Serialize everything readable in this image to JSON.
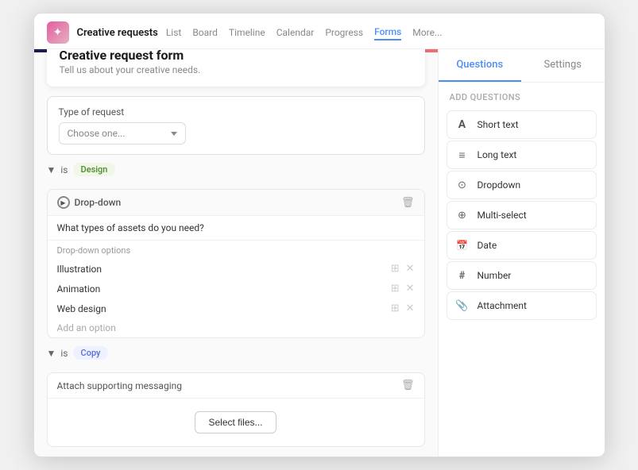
{
  "titleBar": {
    "appTitle": "Creative requests",
    "navItems": [
      "List",
      "Board",
      "Timeline",
      "Calendar",
      "Progress",
      "Forms",
      "More..."
    ],
    "activeNav": "Forms"
  },
  "form": {
    "title": "Creative request form",
    "subtitle": "Tell us about your creative needs.",
    "typeOfRequestLabel": "Type of request",
    "typeOfRequestPlaceholder": "Choose one...",
    "condition1": {
      "prefix": "is",
      "tag": "Design"
    },
    "dropdownSection": {
      "label": "Drop-down",
      "question": "What types of assets do you need?",
      "optionsLabel": "Drop-down options",
      "options": [
        "Illustration",
        "Animation",
        "Web design"
      ],
      "addOptionText": "Add an option"
    },
    "condition2": {
      "prefix": "is",
      "tag": "Copy"
    },
    "attachSection": {
      "label": "Attach supporting messaging",
      "selectFilesBtn": "Select files..."
    }
  },
  "rightPanel": {
    "tabs": [
      "Questions",
      "Settings"
    ],
    "activeTab": "Questions",
    "addQuestionsLabel": "Add questions",
    "questionTypes": [
      {
        "icon": "A",
        "label": "Short text"
      },
      {
        "icon": "≡",
        "label": "Long text"
      },
      {
        "icon": "⊙",
        "label": "Dropdown"
      },
      {
        "icon": "⊕",
        "label": "Multi-select"
      },
      {
        "icon": "☐",
        "label": "Date"
      },
      {
        "icon": "#",
        "label": "Number"
      },
      {
        "icon": "⊘",
        "label": "Attachment"
      }
    ]
  }
}
